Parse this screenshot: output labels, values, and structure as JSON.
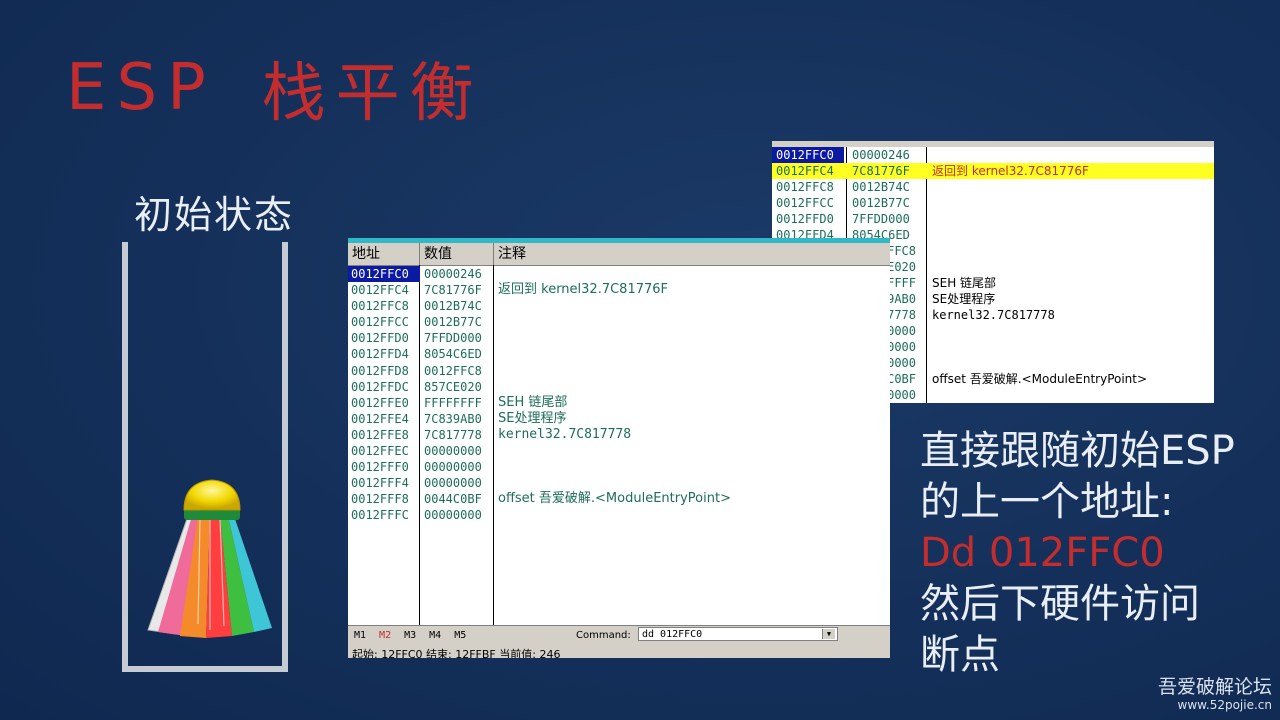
{
  "slide": {
    "title_latin": "ESP",
    "title_cjk": "栈平衡",
    "init_label": "初始状态"
  },
  "main_window": {
    "headers": [
      "地址",
      "数值",
      "注释"
    ],
    "rows": [
      {
        "addr": "0012FFC0",
        "val": "00000246",
        "comment": "",
        "selected": true
      },
      {
        "addr": "0012FFC4",
        "val": "7C81776F",
        "comment": "返回到 kernel32.7C81776F"
      },
      {
        "addr": "0012FFC8",
        "val": "0012B74C",
        "comment": ""
      },
      {
        "addr": "0012FFCC",
        "val": "0012B77C",
        "comment": ""
      },
      {
        "addr": "0012FFD0",
        "val": "7FFDD000",
        "comment": ""
      },
      {
        "addr": "0012FFD4",
        "val": "8054C6ED",
        "comment": ""
      },
      {
        "addr": "0012FFD8",
        "val": "0012FFC8",
        "comment": ""
      },
      {
        "addr": "0012FFDC",
        "val": "857CE020",
        "comment": ""
      },
      {
        "addr": "0012FFE0",
        "val": "FFFFFFFF",
        "comment": "SEH 链尾部"
      },
      {
        "addr": "0012FFE4",
        "val": "7C839AB0",
        "comment": "SE处理程序"
      },
      {
        "addr": "0012FFE8",
        "val": "7C817778",
        "comment": "kernel32.7C817778"
      },
      {
        "addr": "0012FFEC",
        "val": "00000000",
        "comment": ""
      },
      {
        "addr": "0012FFF0",
        "val": "00000000",
        "comment": ""
      },
      {
        "addr": "0012FFF4",
        "val": "00000000",
        "comment": ""
      },
      {
        "addr": "0012FFF8",
        "val": "0044C0BF",
        "comment": "offset 吾爱破解.<ModuleEntryPoint>"
      },
      {
        "addr": "0012FFFC",
        "val": "00000000",
        "comment": ""
      }
    ],
    "tabs": [
      "M1",
      "M2",
      "M3",
      "M4",
      "M5"
    ],
    "command_label": "Command:",
    "command_value": "dd 012FFC0",
    "status_text": "起始: 12FFC0 结束: 12FFBF 当前值: 246"
  },
  "secondary_window": {
    "rows": [
      {
        "addr": "0012FFC0",
        "val": "00000246",
        "comment": "",
        "selected": true
      },
      {
        "addr": "0012FFC4",
        "val": "7C81776F",
        "comment": "返回到 kernel32.7C81776F",
        "highlight": true
      },
      {
        "addr": "0012FFC8",
        "val": "0012B74C",
        "comment": ""
      },
      {
        "addr": "0012FFCC",
        "val": "0012B77C",
        "comment": ""
      },
      {
        "addr": "0012FFD0",
        "val": "7FFDD000",
        "comment": ""
      },
      {
        "addr": "0012FFD4",
        "val": "8054C6ED",
        "comment": ""
      },
      {
        "addr": "",
        "val": "FFC8",
        "comment": ""
      },
      {
        "addr": "",
        "val": "E020",
        "comment": ""
      },
      {
        "addr": "",
        "val": "FFFF",
        "comment": "SEH 链尾部"
      },
      {
        "addr": "",
        "val": "9AB0",
        "comment": "SE处理程序"
      },
      {
        "addr": "",
        "val": "7778",
        "comment": "kernel32.7C817778"
      },
      {
        "addr": "",
        "val": "0000",
        "comment": ""
      },
      {
        "addr": "",
        "val": "0000",
        "comment": ""
      },
      {
        "addr": "",
        "val": "0000",
        "comment": ""
      },
      {
        "addr": "",
        "val": "C0BF",
        "comment": "offset 吾爱破解.<ModuleEntryPoint>"
      },
      {
        "addr": "",
        "val": "0000",
        "comment": ""
      }
    ]
  },
  "explanation": {
    "line1": "直接跟随初始ESP",
    "line2": "的上一个地址:",
    "line3": "Dd 012FFC0",
    "line4": "然后下硬件访问",
    "line5": "断点"
  },
  "footer": {
    "brand": "吾爱破解论坛",
    "url": "www.52pojie.cn"
  },
  "colors": {
    "background": "#15305a",
    "title_red": "#c42d2d",
    "text_white": "#e9eef5",
    "row_green": "#1c6d5a",
    "selection_blue": "#0b1aa0",
    "highlight_yellow": "#ffff22"
  }
}
